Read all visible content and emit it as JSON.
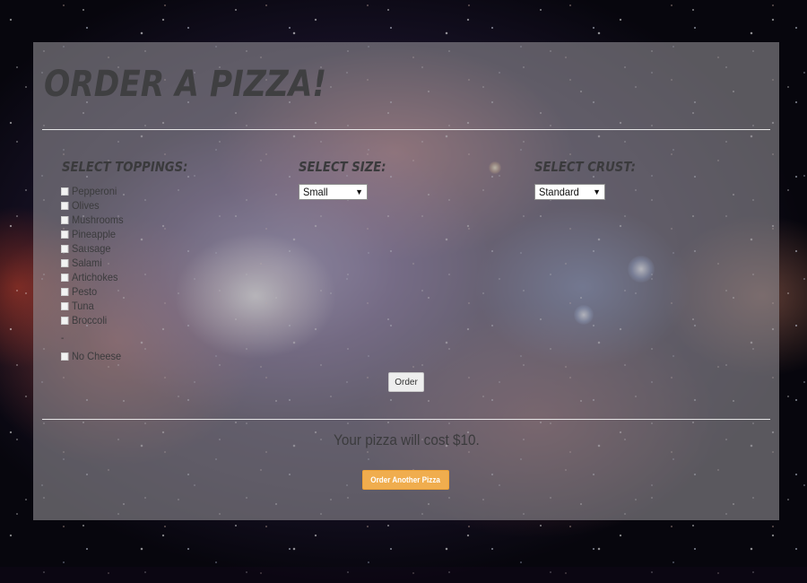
{
  "page": {
    "title": "Order a Pizza!"
  },
  "toppings": {
    "heading": "Select Toppings:",
    "items": [
      {
        "label": "Pepperoni",
        "checked": false
      },
      {
        "label": "Olives",
        "checked": false
      },
      {
        "label": "Mushrooms",
        "checked": false
      },
      {
        "label": "Pineapple",
        "checked": false
      },
      {
        "label": "Sausage",
        "checked": false
      },
      {
        "label": "Salami",
        "checked": false
      },
      {
        "label": "Artichokes",
        "checked": false
      },
      {
        "label": "Pesto",
        "checked": false
      },
      {
        "label": "Tuna",
        "checked": false
      },
      {
        "label": "Broccoli",
        "checked": false
      }
    ],
    "separator": "-",
    "no_cheese": {
      "label": "No Cheese",
      "checked": false
    }
  },
  "size": {
    "heading": "Select Size:",
    "selected": "Small"
  },
  "crust": {
    "heading": "Select Crust:",
    "selected": "Standard"
  },
  "actions": {
    "order_label": "Order",
    "order_another_label": "Order Another Pizza"
  },
  "result": {
    "cost_text": "Your pizza will cost $10."
  },
  "colors": {
    "panel_overlay": "#8e8a92",
    "title_text": "#3f3f41",
    "order_another_button": "#f0ad4e",
    "rule": "#f5f5f5"
  },
  "icons": {
    "dropdown": "caret-down-icon",
    "checkbox": "checkbox-icon"
  }
}
